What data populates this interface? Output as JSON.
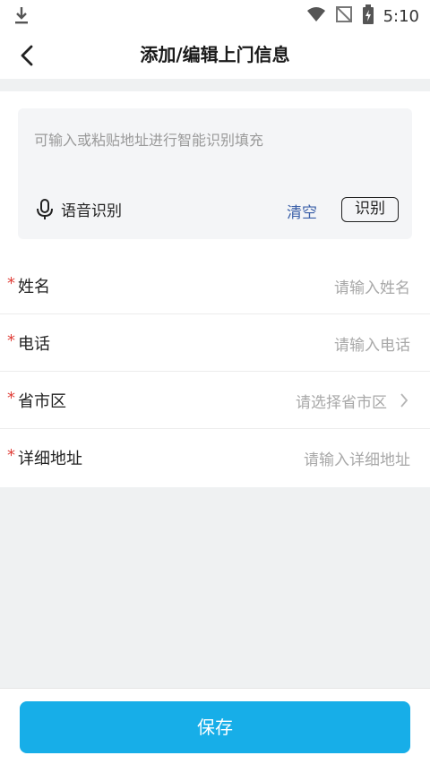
{
  "status_bar": {
    "time": "5:10"
  },
  "header": {
    "title": "添加/编辑上门信息"
  },
  "smart_input": {
    "placeholder": "可输入或粘贴地址进行智能识别填充",
    "voice_label": "语音识别",
    "clear_label": "清空",
    "recognize_label": "识别"
  },
  "form": {
    "required_mark": "*",
    "fields": [
      {
        "label": "姓名",
        "placeholder": "请输入姓名"
      },
      {
        "label": "电话",
        "placeholder": "请输入电话"
      },
      {
        "label": "省市区",
        "placeholder": "请选择省市区"
      },
      {
        "label": "详细地址",
        "placeholder": "请输入详细地址"
      }
    ]
  },
  "footer": {
    "save_label": "保存"
  },
  "colors": {
    "accent": "#17aee8",
    "required": "#e0403a",
    "link": "#3a5fa8"
  }
}
